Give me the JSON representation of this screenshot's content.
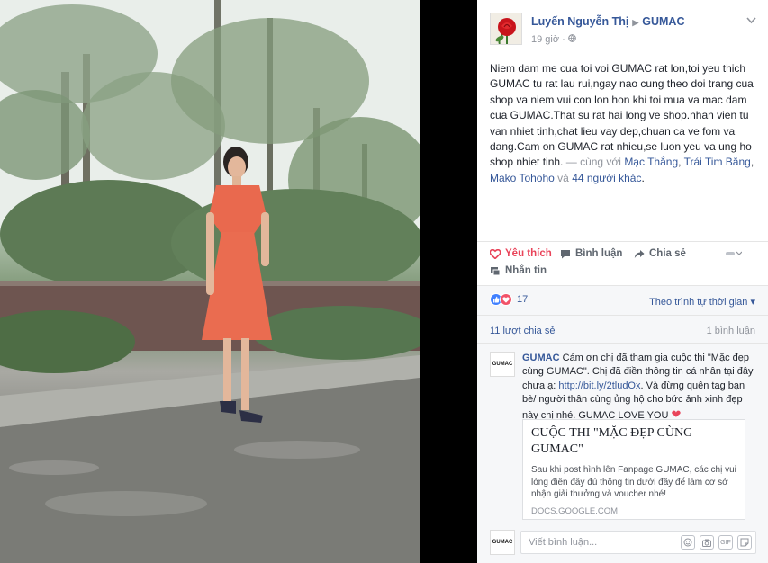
{
  "post": {
    "author": "Luyến Nguyễn Thị",
    "page": "GUMAC",
    "time": "19 giờ",
    "text_main": "Niem dam me cua toi voi GUMAC rat lon,toi yeu thich GUMAC tu rat lau rui,ngay nao cung theo doi trang cua shop va niem vui con lon hon khi toi mua va mac dam cua GUMAC.That su rat hai long ve shop.nhan vien tu van nhiet tinh,chat lieu vay dep,chuan ca ve fom va dang.Cam on GUMAC rat nhieu,se luon yeu va ung ho shop nhiet tinh.",
    "with_prefix": " — cùng với ",
    "tagged": [
      "Mạc Thắng",
      "Trái Tim Băng",
      "Mako Tohoho"
    ],
    "sep1": ", ",
    "sep2": ", ",
    "and": " và ",
    "others": "44 người khác",
    "end": "."
  },
  "actions": {
    "like": "Yêu thích",
    "comment": "Bình luận",
    "share": "Chia sẻ",
    "message": "Nhắn tin"
  },
  "reactions": {
    "count": "17",
    "sort_label": "Theo trình tự thời gian ▾"
  },
  "stats": {
    "shares": "11 lượt chia sẻ",
    "comments": "1 bình luận"
  },
  "comment": {
    "author": "GUMAC",
    "avatar_text": "GUMAC",
    "text1": " Cám ơn chị đã tham gia cuộc thi \"Mặc đẹp cùng GUMAC\". Chị đã điền thông tin cá nhân tại đây chưa ạ: ",
    "link": "http://bit.ly/2tludOx",
    "text2": ". Và đừng quên tag bạn bè/ người thân cùng ủng hộ cho bức ảnh xinh đẹp này chị nhé. GUMAC LOVE YOU ",
    "heart": "❤"
  },
  "card": {
    "title": "CUỘC THI \"MẶC ĐẸP CÙNG GUMAC\"",
    "description": "Sau khi post hình lên Fanpage GUMAC, các chị vui lòng điền đầy đủ thông tin dưới đây để làm cơ sở nhận giải thưởng và voucher nhé!",
    "domain": "DOCS.GOOGLE.COM"
  },
  "composer": {
    "avatar_text": "GUMAC",
    "placeholder": "Viết bình luận...",
    "icons": [
      "emoji-icon",
      "camera-icon",
      "gif-icon",
      "sticker-icon"
    ]
  },
  "colors": {
    "link": "#365899",
    "love": "#e9445a",
    "like": "#4080ff"
  }
}
